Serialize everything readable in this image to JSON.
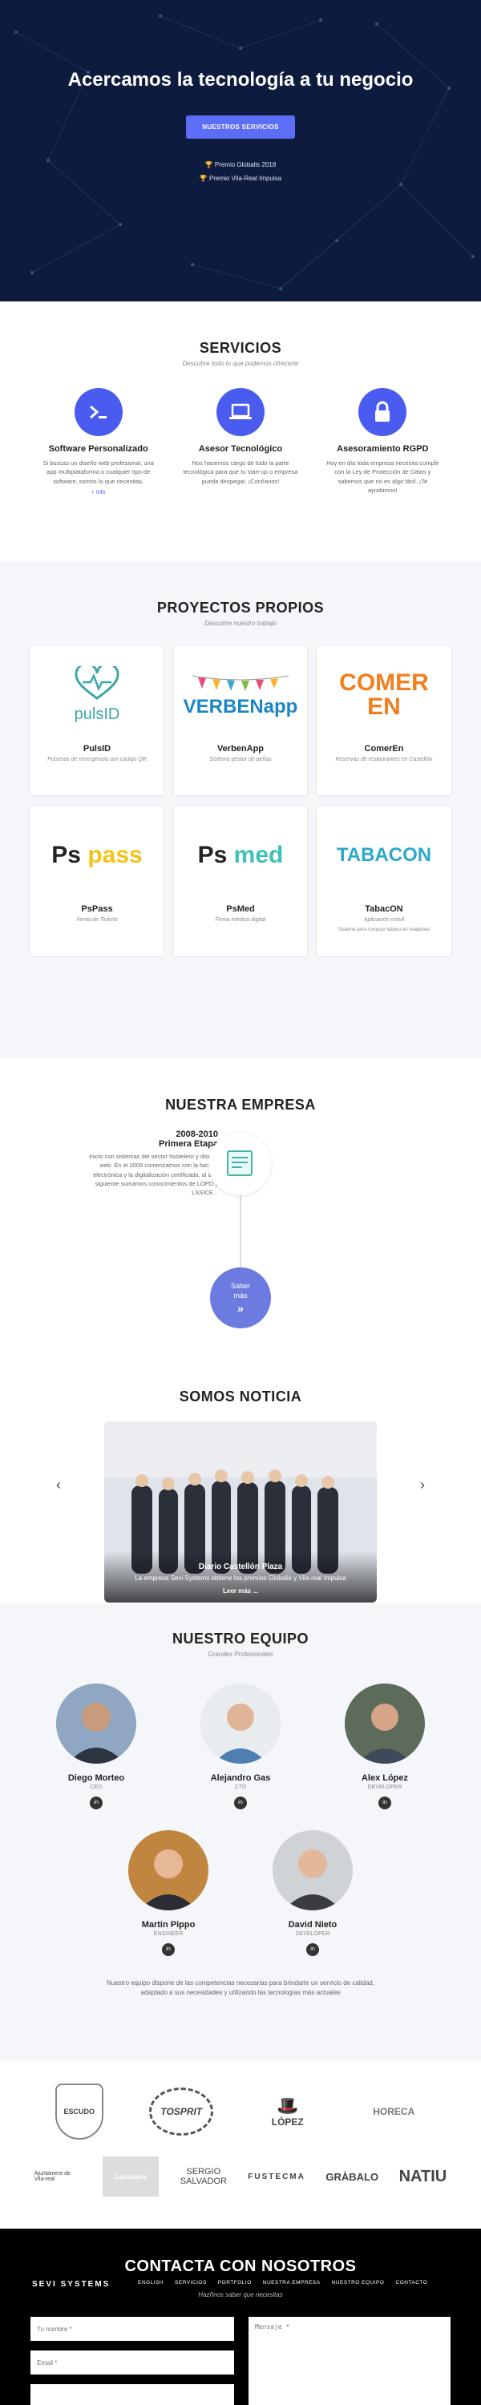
{
  "hero": {
    "title": "Acercamos la tecnología a tu negocio",
    "cta": "NUESTROS SERVICIOS",
    "awards": [
      "Premio Globalis 2018",
      "Premio Vila-Real Impulsa"
    ]
  },
  "services": {
    "title": "SERVICIOS",
    "subtitle": "Descubre todo lo que podemos ofrecerte",
    "items": [
      {
        "title": "Software Personalizado",
        "text": "Si buscas un diseño web profesional, una app multiplataforma o cualquier tipo de software, somos lo que necesitas.",
        "link": "+ Info",
        "icon": "terminal-icon"
      },
      {
        "title": "Asesor Tecnológico",
        "text": "Nos hacemos cargo de todo la parte tecnológica para que tu start-up o empresa pueda despegar. ¡Confíanos!",
        "link": "",
        "icon": "laptop-icon"
      },
      {
        "title": "Asesoramiento RGPD",
        "text": "Hoy en día toda empresa necesita cumplir con la Ley de Protección de Datos y sabemos que no es algo fácil. ¡Te ayudamos!",
        "link": "",
        "icon": "lock-icon"
      }
    ]
  },
  "projects": {
    "title": "PROYECTOS PROPIOS",
    "subtitle": "Descubre nuestro trabajo",
    "items": [
      {
        "name": "PulsID",
        "desc": "Pulseras de emergencia con código QR",
        "logo": "pulsID"
      },
      {
        "name": "VerbenApp",
        "desc": "Sistema gestor de peñas",
        "logo": "VERBENapp"
      },
      {
        "name": "ComerEn",
        "desc": "Reservas de restaurantes en Castellón",
        "logo": "COMER EN"
      },
      {
        "name": "PsPass",
        "desc": "Venta de Tickets",
        "logo": "Ps pass"
      },
      {
        "name": "PsMed",
        "desc": "Firma médica digital",
        "logo": "Ps med"
      },
      {
        "name": "TabacON",
        "desc": "Aplicación móvil",
        "desc2": "Sistema para comprar tabaco en máquinas",
        "logo": "TABACON"
      }
    ]
  },
  "company": {
    "title": "NUESTRA EMPRESA",
    "year": "2008-2010",
    "phase": "Primera Etapa",
    "body": "Inicio con sistemas del sector hostelero y diseño web. En el 2009 comenzamos con la factura electrónica y la digitalización certificada, al año siguiente sumamos conocimientos de LOPD y LSSICE...",
    "more": "Saber más"
  },
  "news": {
    "title": "SOMOS NOTICIA",
    "source": "Diario Castellón Plaza",
    "text": "La empresa Sevi Systems obtiene los premios Globalis y Vila-real Impulsa",
    "more": "Leer más ..."
  },
  "team": {
    "title": "NUESTRO EQUIPO",
    "subtitle": "Grandes Profesionales",
    "members": [
      {
        "name": "Diego Morteo",
        "role": "CEO"
      },
      {
        "name": "Alejandro Gas",
        "role": "CTO"
      },
      {
        "name": "Alex López",
        "role": "DEVELOPER"
      },
      {
        "name": "Martin Pippo",
        "role": "ENGINEER"
      },
      {
        "name": "David Nieto",
        "role": "DEVELOPER"
      }
    ],
    "note": "Nuestro equipo dispone de las competencias necesarias para brindarte un servicio de calidad, adaptado a sus necesidades y utilizando las tecnologías más actuales"
  },
  "partners": {
    "row1": [
      "ESCUDO",
      "TOSPRIT",
      "LÓPEZ",
      "HORECA"
    ],
    "row2": [
      "Ajuntament de Vila-real",
      "Lanzadera",
      "SERGIO SALVADOR",
      "FUSTECMA",
      "GRÀBALO",
      "NATIU"
    ]
  },
  "footer": {
    "brand": "SEVI SYSTEMS",
    "title": "CONTACTA CON NOSOTROS",
    "subtitle": "Hazñnos saber que necesitas",
    "nav": [
      "ENGLISH",
      "SERVICIOS",
      "PORTFOLIO",
      "NUESTRA EMPRESA",
      "NUESTRO EQUIPO",
      "CONTACTO"
    ],
    "name_placeholder": "Tu nombre *",
    "email_placeholder": "Email *",
    "message_placeholder": "Mensaje *"
  }
}
